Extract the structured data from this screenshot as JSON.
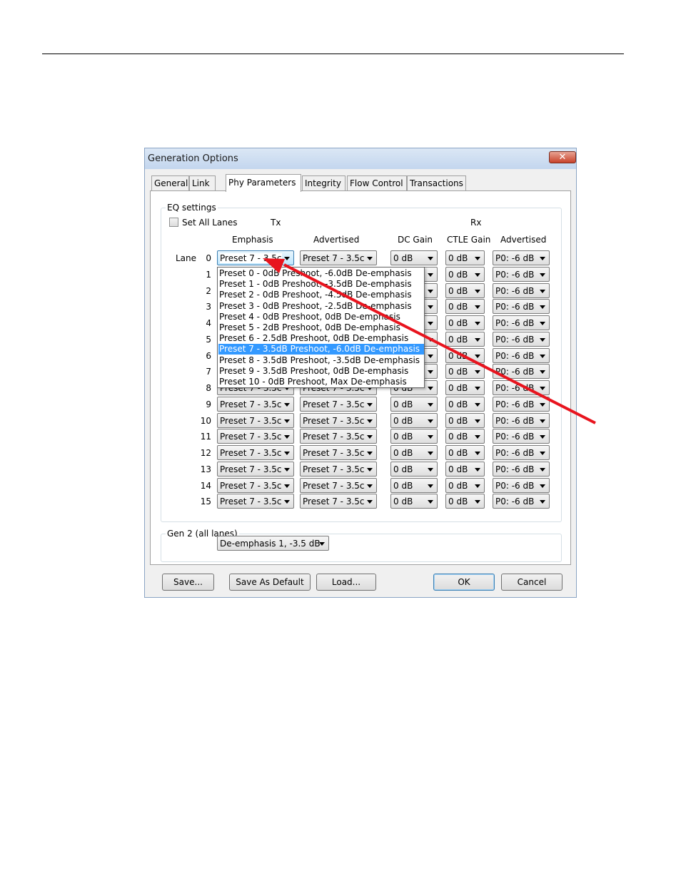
{
  "dialog": {
    "title": "Generation Options",
    "close_icon": "close-icon",
    "tabs": [
      "General",
      "Link",
      "Phy Parameters",
      "Integrity",
      "Flow Control",
      "Transactions"
    ],
    "active_tab": "Phy Parameters"
  },
  "eq": {
    "group_label": "EQ settings",
    "set_all_lanes": "Set All Lanes",
    "set_all_checked": false,
    "tx_label": "Tx",
    "rx_label": "Rx",
    "col_emphasis": "Emphasis",
    "col_advertised": "Advertised",
    "col_dc_gain": "DC Gain",
    "col_ctle_gain": "CTLE Gain",
    "col_rx_advertised": "Advertised",
    "lane_label": "Lane",
    "lanes": [
      "0",
      "1",
      "2",
      "3",
      "4",
      "5",
      "6",
      "7",
      "8",
      "9",
      "10",
      "11",
      "12",
      "13",
      "14",
      "15"
    ],
    "emphasis_value": "Preset 7 - 3.5c",
    "advertised_value": "Preset 7 - 3.5c",
    "dc_gain_value": "0  dB",
    "ctle_gain_value": "0 dB",
    "rx_advertised_value": "P0: -6 dB"
  },
  "dropdown": {
    "options": [
      "Preset 0 - 0dB Preshoot, -6.0dB De-emphasis",
      "Preset 1 - 0dB Preshoot, -3.5dB De-emphasis",
      "Preset 2 - 0dB Preshoot, -4.5dB De-emphasis",
      "Preset 3 - 0dB Preshoot, -2.5dB De-emphasis",
      "Preset 4 - 0dB Preshoot, 0dB De-emphasis",
      "Preset 5 - 2dB Preshoot, 0dB De-emphasis",
      "Preset 6 - 2.5dB Preshoot, 0dB De-emphasis",
      "Preset 7 - 3.5dB Preshoot, -6.0dB De-emphasis",
      "Preset 8 - 3.5dB Preshoot, -3.5dB De-emphasis",
      "Preset 9 - 3.5dB Preshoot, 0dB De-emphasis",
      "Preset 10 - 0dB Preshoot, Max De-emphasis"
    ],
    "selected_index": 7,
    "highlight_color": "#3399ff"
  },
  "gen2": {
    "group_label": "Gen 2 (all lanes)",
    "value": "De-emphasis 1, -3.5 dB"
  },
  "buttons": {
    "save": "Save...",
    "save_default": "Save As Default",
    "load": "Load...",
    "ok": "OK",
    "cancel": "Cancel"
  },
  "annotation": {
    "arrow_color": "#e8141e"
  }
}
